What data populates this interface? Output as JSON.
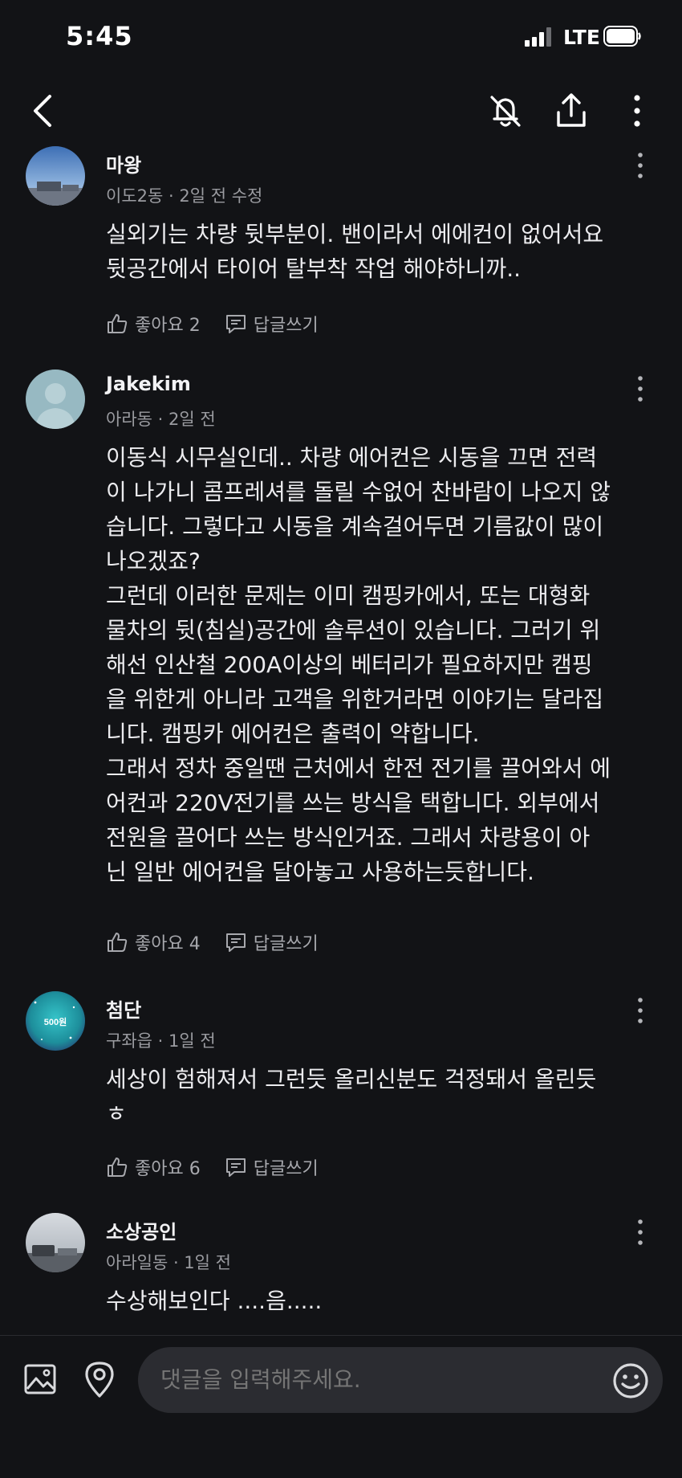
{
  "status": {
    "time": "5:45",
    "network": "LTE"
  },
  "header": {
    "back_icon": "chevron-left-icon",
    "icons": [
      "bell-off-icon",
      "share-icon",
      "more-vertical-icon"
    ]
  },
  "comments": [
    {
      "author": "마왕",
      "meta": "이도2동 · 2일 전 수정",
      "body": "실외기는 차량 뒷부분이. 밴이라서 에에컨이 없어서요\n뒷공간에서 타이어 탈부착 작업 해야하니까..",
      "like_label": "좋아요 2",
      "reply_label": "답글쓰기"
    },
    {
      "author": "Jakekim",
      "meta": "아라동 · 2일 전",
      "body": "이동식 시무실인데.. 차량 에어컨은 시동을 끄면 전력\n이 나가니 콤프레셔를 돌릴 수없어 찬바람이 나오지 않\n습니다. 그렇다고 시동을 계속걸어두면 기름값이 많이\n나오겠죠?\n그런데 이러한 문제는 이미 캠핑카에서, 또는 대형화\n물차의 뒷(침실)공간에 솔루션이 있습니다. 그러기 위\n해선 인산철 200A이상의 베터리가 필요하지만 캠핑\n을 위한게 아니라 고객을 위한거라면 이야기는 달라집\n니다. 캠핑카 에어컨은 출력이 약합니다.\n그래서 정차 중일땐 근처에서 한전 전기를 끌어와서 에\n어컨과 220V전기를 쓰는 방식을 택합니다. 외부에서\n전원을 끌어다 쓰는 방식인거죠. 그래서 차량용이 아\n닌 일반 에어컨을 달아놓고 사용하는듯합니다.",
      "like_label": "좋아요 4",
      "reply_label": "답글쓰기"
    },
    {
      "author": "첨단",
      "meta": "구좌읍 · 1일 전",
      "avatar_text": "500원",
      "body": "세상이 험해져서 그런듯 올리신분도 걱정돼서 올린듯\nㅎ",
      "like_label": "좋아요 6",
      "reply_label": "답글쓰기"
    },
    {
      "author": "소상공인",
      "meta": "아라일동 · 1일 전",
      "body": "수상해보인다 ....음.....",
      "like_label": "",
      "reply_label": ""
    }
  ],
  "composer": {
    "placeholder": "댓글을 입력해주세요.",
    "icons": [
      "image-icon",
      "location-pin-icon",
      "emoji-icon"
    ]
  }
}
